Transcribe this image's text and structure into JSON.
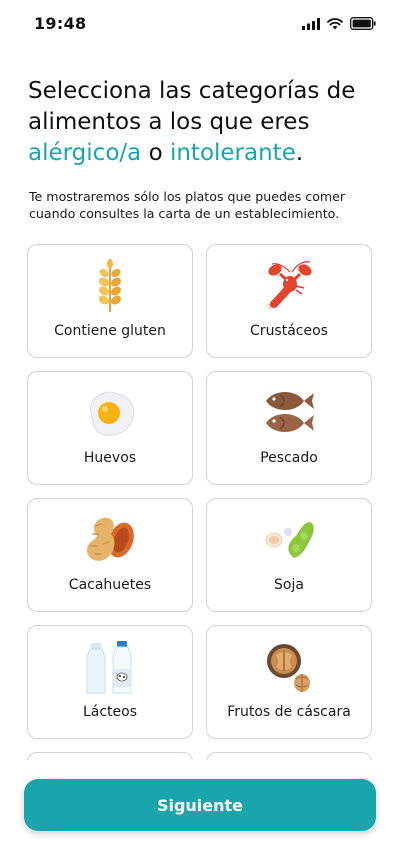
{
  "status_bar": {
    "time": "19:48",
    "icons": [
      "cellular-signal-icon",
      "wifi-icon",
      "battery-icon"
    ]
  },
  "header": {
    "title_line1": "Selecciona las categorías de",
    "title_line2": "alimentos a los que eres",
    "title_accent1": "alérgico/a",
    "title_connector": "o",
    "title_accent2": "intolerante",
    "title_period": ".",
    "subtitle": "Te mostraremos sólo los platos que puedes comer cuando consultes la carta de un establecimiento."
  },
  "categories": [
    {
      "label": "Contiene gluten",
      "icon": "wheat-icon"
    },
    {
      "label": "Crustáceos",
      "icon": "lobster-icon"
    },
    {
      "label": "Huevos",
      "icon": "fried-egg-icon"
    },
    {
      "label": "Pescado",
      "icon": "fish-icon"
    },
    {
      "label": "Cacahuetes",
      "icon": "peanut-icon"
    },
    {
      "label": "Soja",
      "icon": "soybean-icon"
    },
    {
      "label": "Lácteos",
      "icon": "milk-icon"
    },
    {
      "label": "Frutos de cáscara",
      "icon": "walnut-icon"
    },
    {
      "label": "",
      "icon": ""
    },
    {
      "label": "",
      "icon": ""
    }
  ],
  "footer": {
    "next_label": "Siguiente"
  },
  "colors": {
    "accent": "#1aa5ad",
    "card_border": "#d3d3d3",
    "text": "#1a1a1a"
  }
}
